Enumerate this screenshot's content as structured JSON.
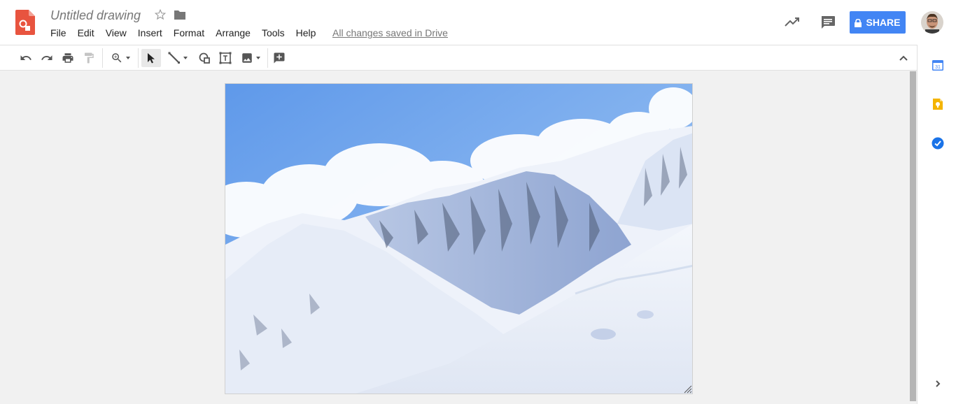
{
  "app": {
    "doc_title": "Untitled drawing",
    "save_status": "All changes saved in Drive",
    "icons": {
      "logo": "drawings-logo-icon",
      "star": "star-icon",
      "folder": "folder-icon"
    }
  },
  "menu": {
    "items": [
      {
        "label": "File"
      },
      {
        "label": "Edit"
      },
      {
        "label": "View"
      },
      {
        "label": "Insert"
      },
      {
        "label": "Format"
      },
      {
        "label": "Arrange"
      },
      {
        "label": "Tools"
      },
      {
        "label": "Help"
      }
    ]
  },
  "header_actions": {
    "share_label": "SHARE",
    "share_color": "#4285f4",
    "icons": [
      "activity-trend-icon",
      "comments-icon",
      "lock-icon",
      "avatar"
    ]
  },
  "toolbar": {
    "tools": [
      "undo-icon",
      "redo-icon",
      "print-icon",
      "paint-format-icon",
      "zoom-icon",
      "select-arrow-icon",
      "line-icon",
      "shape-icon",
      "text-box-icon",
      "image-icon",
      "add-comment-icon",
      "collapse-chevron-icon"
    ],
    "active_tool": "select-arrow-icon"
  },
  "side_panel": {
    "icons": [
      "calendar-icon",
      "keep-icon",
      "tasks-icon",
      "expand-chevron-icon"
    ],
    "calendar_label": "31"
  },
  "canvas": {
    "image_subject": "snow-covered mountain range under blue sky with clouds"
  }
}
